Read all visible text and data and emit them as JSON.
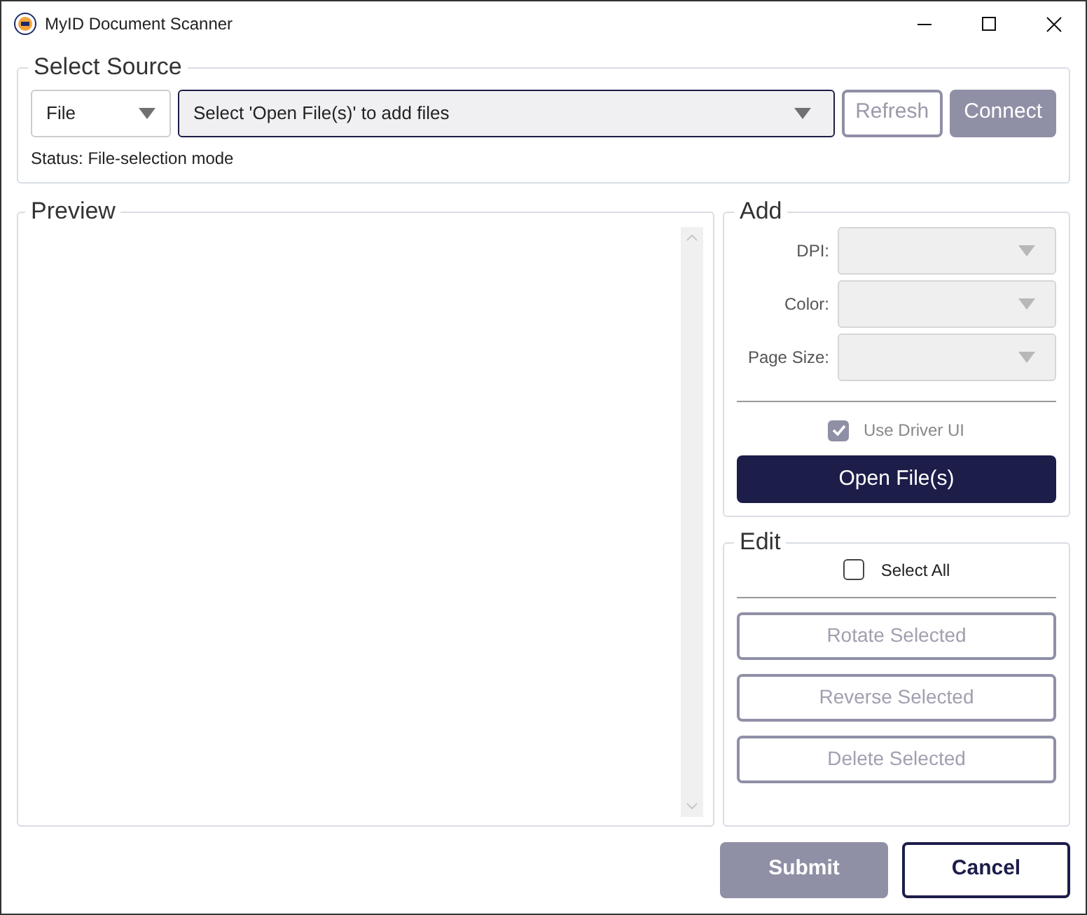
{
  "window": {
    "title": "MyID Document Scanner"
  },
  "select_source": {
    "title": "Select Source",
    "source": {
      "value": "File"
    },
    "device": {
      "value": "Select 'Open File(s)' to add files"
    },
    "buttons": [
      {
        "label": "Refresh",
        "kind": "outline",
        "disabled": true
      },
      {
        "label": "Connect",
        "kind": "filled",
        "disabled": true
      }
    ],
    "status": "Status: File-selection mode"
  },
  "preview": {
    "title": "Preview"
  },
  "add": {
    "title": "Add",
    "fields": [
      {
        "label": "DPI:",
        "disabled": true
      },
      {
        "label": "Color:",
        "disabled": true
      },
      {
        "label": "Page Size:",
        "disabled": true
      }
    ],
    "use_driver_ui": {
      "label": "Use Driver UI",
      "checked": true,
      "disabled": true
    },
    "open_button": {
      "label": "Open File(s)"
    }
  },
  "edit": {
    "title": "Edit",
    "select_all": {
      "label": "Select All",
      "checked": false
    },
    "buttons": [
      {
        "label": "Rotate Selected",
        "disabled": true
      },
      {
        "label": "Reverse Selected",
        "disabled": true
      },
      {
        "label": "Delete Selected",
        "disabled": true
      }
    ]
  },
  "footer": {
    "buttons": [
      {
        "label": "Submit",
        "kind": "primary",
        "disabled": true
      },
      {
        "label": "Cancel",
        "kind": "secondary",
        "disabled": false
      }
    ]
  }
}
